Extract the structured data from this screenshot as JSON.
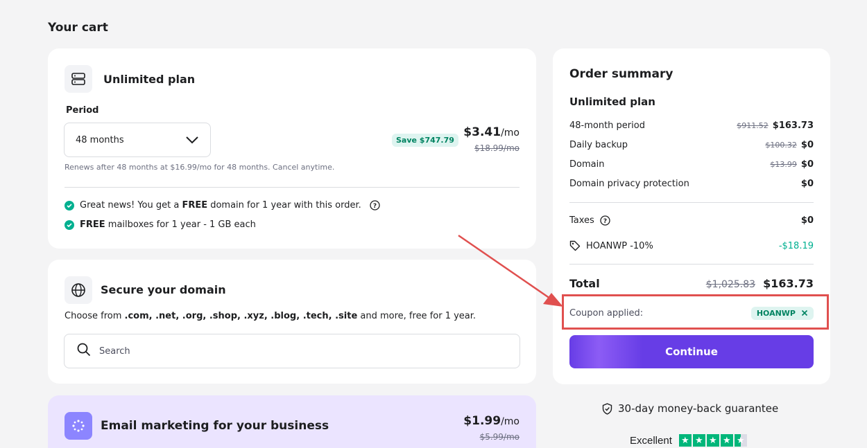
{
  "page_title": "Your cart",
  "plan_card": {
    "title": "Unlimited plan",
    "period_label": "Period",
    "period_value": "48 months",
    "save_badge": "Save $747.79",
    "price": "$3.41",
    "price_unit": "/mo",
    "old_price": "$18.99/mo",
    "renew_note": "Renews after 48 months at $16.99/mo for 48 months. Cancel anytime.",
    "benefit1_pre": "Great news! You get a ",
    "benefit1_bold": "FREE",
    "benefit1_post": " domain for 1 year with this order.",
    "benefit2_bold": "FREE",
    "benefit2_post": " mailboxes for 1 year - 1 GB each"
  },
  "domain_card": {
    "title": "Secure your domain",
    "desc_pre": "Choose from ",
    "desc_tlds": ".com, .net, .org, .shop, .xyz, .blog, .tech, .site",
    "desc_post": " and more, free for 1 year.",
    "search_placeholder": "Search"
  },
  "email_card": {
    "title": "Email marketing for your business",
    "price": "$1.99",
    "price_unit": "/mo",
    "old_price": "$5.99/mo"
  },
  "summary": {
    "title": "Order summary",
    "plan": "Unlimited plan",
    "lines": [
      {
        "label": "48-month period",
        "old": "$911.52",
        "value": "$163.73"
      },
      {
        "label": "Daily backup",
        "old": "$100.32",
        "value": "$0"
      },
      {
        "label": "Domain",
        "old": "$13.99",
        "value": "$0"
      },
      {
        "label": "Domain privacy protection",
        "old": "",
        "value": "$0"
      }
    ],
    "taxes_label": "Taxes",
    "taxes_value": "$0",
    "discount_label": "HOANWP -10%",
    "discount_value": "-$18.19",
    "total_label": "Total",
    "total_old": "$1,025.83",
    "total_value": "$163.73",
    "coupon_label": "Coupon applied:",
    "coupon_code": "HOANWP",
    "continue_label": "Continue"
  },
  "guarantee": "30-day money-back guarantee",
  "rating_label": "Excellent",
  "rating_stars": 4.5,
  "colors": {
    "accent": "#673de6",
    "success": "#00b090",
    "annotation": "#e0504f"
  }
}
